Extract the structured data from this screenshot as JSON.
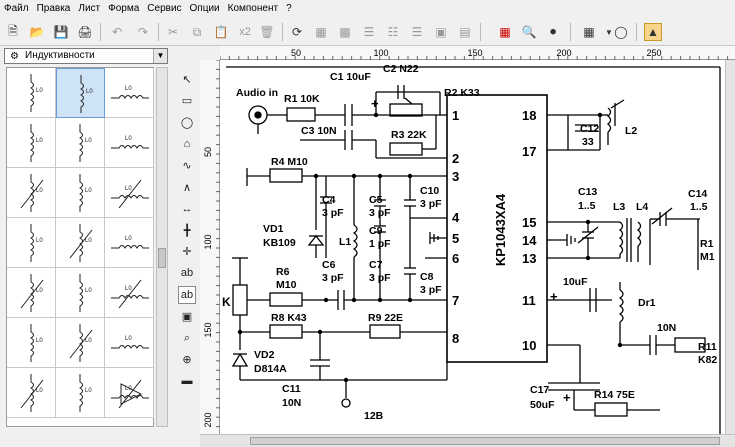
{
  "menu": [
    "Файл",
    "Правка",
    "Лист",
    "Форма",
    "Сервис",
    "Опции",
    "Компонент",
    "?"
  ],
  "toolbar": {
    "zoom_label": "x2",
    "buttons": [
      "new-icon",
      "open-icon",
      "save-icon",
      "print-icon",
      "undo-icon",
      "redo-icon",
      "cut-icon",
      "copy-icon",
      "paste-icon",
      "zoom-icon",
      "delete-icon",
      "rotate-icon",
      "mirror-h-icon",
      "mirror-v-icon",
      "align-icon",
      "group-icon",
      "netlist-icon",
      "find-icon",
      "grid-icon",
      "zoom-fit-icon",
      "macro-icon"
    ]
  },
  "library": {
    "selected": "Индуктивности",
    "symbol_label": "L0"
  },
  "tools": [
    "pointer-icon",
    "rectangle-icon",
    "ellipse-icon",
    "polygon-icon",
    "bezier-icon",
    "polyline-icon",
    "measure-icon",
    "wire-icon",
    "junction-icon",
    "text-icon",
    "text-box-icon",
    "image-icon",
    "zoom-icon",
    "magnify-icon",
    "scale-icon"
  ],
  "ruler": {
    "h_ticks": [
      "50",
      "100",
      "150",
      "200",
      "250"
    ],
    "v_ticks": [
      "50",
      "100",
      "150",
      "200"
    ]
  },
  "schematic": {
    "chip": "KP1043XA4",
    "pins": [
      "1",
      "2",
      "3",
      "4",
      "5",
      "6",
      "7",
      "8",
      "10",
      "11",
      "13",
      "14",
      "15",
      "17",
      "18"
    ],
    "labels": {
      "audio": "Audio in",
      "r1": "R1 10K",
      "c1": "C1 10uF",
      "c2": "C2 N22",
      "r2": "R2 K33",
      "c3": "C3 10N",
      "r3": "R3 22K",
      "r4": "R4 M10",
      "c4": "C4",
      "c4v": "3 pF",
      "c5": "C5",
      "c5v": "3 pF",
      "c10": "C10",
      "c10v": "3 pF",
      "c9": "C9",
      "c9v": "1 pF",
      "l1": "L1",
      "c6": "C6",
      "c6v": "3 pF",
      "c7": "C7",
      "c7v": "3 pF",
      "c8": "C8",
      "c8v": "3 pF",
      "vd1": "VD1",
      "vd1v": "KB109",
      "r6": "R6",
      "r6v": "M10",
      "k": "K",
      "r8": "R8 K43",
      "r9": "R9 22E",
      "vd2": "VD2",
      "vd2v": "D814A",
      "c11": "C11",
      "c11v": "10N",
      "v12": "12B",
      "c12": "C12",
      "c12v": "33",
      "l2": "L2",
      "c13": "C13",
      "c13v": "1..5",
      "l3": "L3",
      "l4": "L4",
      "c14": "C14",
      "c14v": "1..5",
      "r1r": "R1",
      "m1": "M1",
      "c10u": "10uF",
      "dr1": "Dr1",
      "n10": "10N",
      "r11": "R11",
      "k82": "K82",
      "c17": "C17",
      "c17v": "50uF",
      "r14": "R14 75E"
    }
  },
  "colors": {
    "canvas_bg": "#ffffff",
    "chrome_bg": "#f0f0f0",
    "selection": "#cfe3f7"
  }
}
